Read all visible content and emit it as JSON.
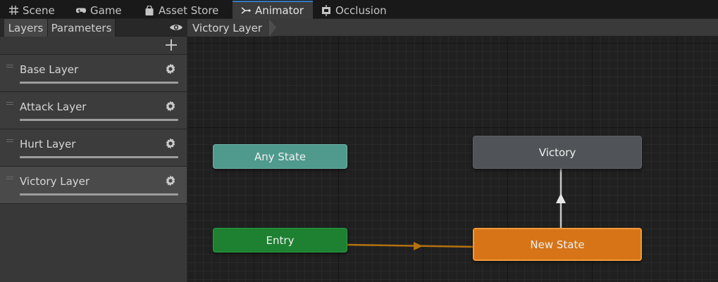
{
  "tabs": [
    {
      "label": "Scene",
      "icon": "grid-icon"
    },
    {
      "label": "Game",
      "icon": "gamepad-icon"
    },
    {
      "label": "Asset Store",
      "icon": "bag-icon"
    },
    {
      "label": "Animator",
      "icon": "animator-icon",
      "active": true
    },
    {
      "label": "Occlusion",
      "icon": "occlusion-icon"
    }
  ],
  "left_panel": {
    "subtabs": [
      {
        "label": "Layers",
        "active": true
      },
      {
        "label": "Parameters"
      }
    ],
    "layers": [
      {
        "name": "Base Layer"
      },
      {
        "name": "Attack Layer"
      },
      {
        "name": "Hurt Layer"
      },
      {
        "name": "Victory Layer",
        "selected": true
      }
    ]
  },
  "breadcrumb": {
    "label": "Victory Layer"
  },
  "graph": {
    "nodes": {
      "any_state": "Any State",
      "entry": "Entry",
      "victory": "Victory",
      "new_state": "New State"
    }
  },
  "colors": {
    "accent_tab": "#3a79bb",
    "any_state": "#4f9a8d",
    "entry": "#1d8131",
    "default_state": "#d67417",
    "state": "#505358",
    "entry_transition": "#b4720f",
    "transition": "#c8c8c8"
  }
}
